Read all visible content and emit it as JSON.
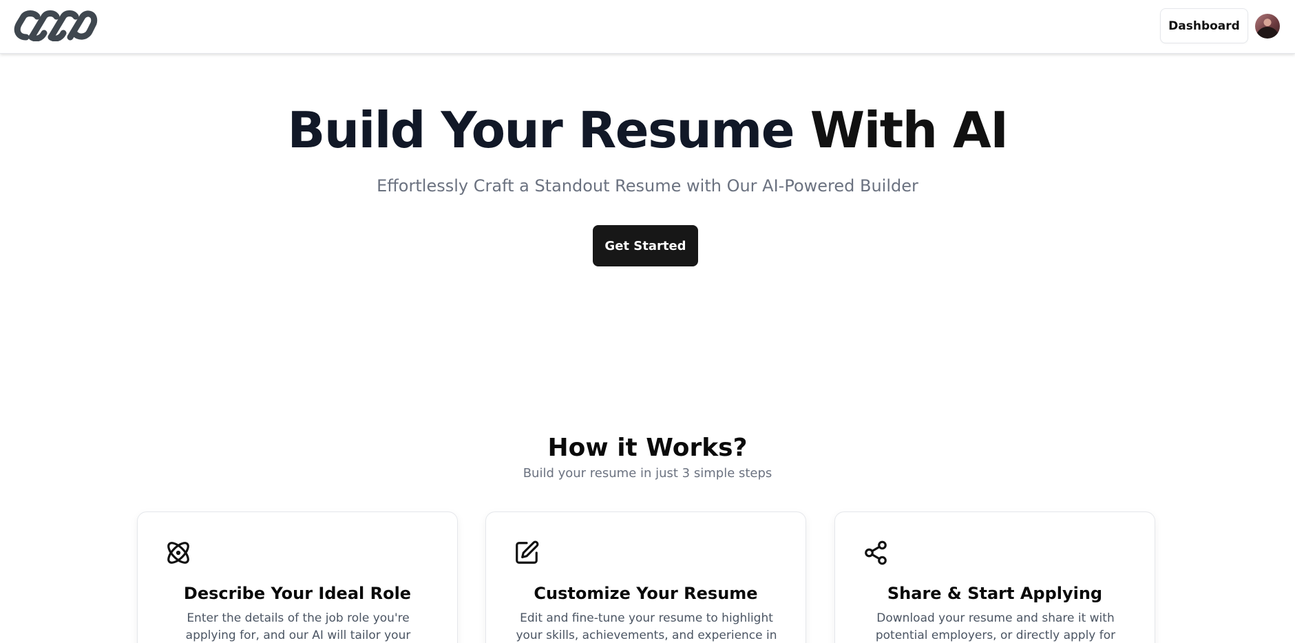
{
  "header": {
    "logo_icon": "chain-link-logo",
    "dashboard_label": "Dashboard",
    "avatar_icon": "user-avatar"
  },
  "hero": {
    "title_part1": "Build Your Resume",
    "title_part2": "With AI",
    "subtitle": "Effortlessly Craft a Standout Resume with Our AI-Powered Builder",
    "cta_label": "Get Started"
  },
  "how": {
    "title": "How it Works?",
    "subtitle": "Build your resume in just 3 simple steps",
    "cards": [
      {
        "icon": "atom-icon",
        "title": "Describe Your Ideal Role",
        "description": "Enter the details of the job role you're applying for, and our AI will tailor your resume to match it"
      },
      {
        "icon": "edit-icon",
        "title": "Customize Your Resume",
        "description": "Edit and fine-tune your resume to highlight your skills, achievements, and experience in the best"
      },
      {
        "icon": "share-icon",
        "title": "Share & Start Applying",
        "description": "Download your resume and share it with potential employers, or directly apply for jobs"
      }
    ]
  },
  "colors": {
    "primary_button": "#171717",
    "title_text": "#111827",
    "muted_text": "#6b7280",
    "logo": "#3f474f"
  }
}
